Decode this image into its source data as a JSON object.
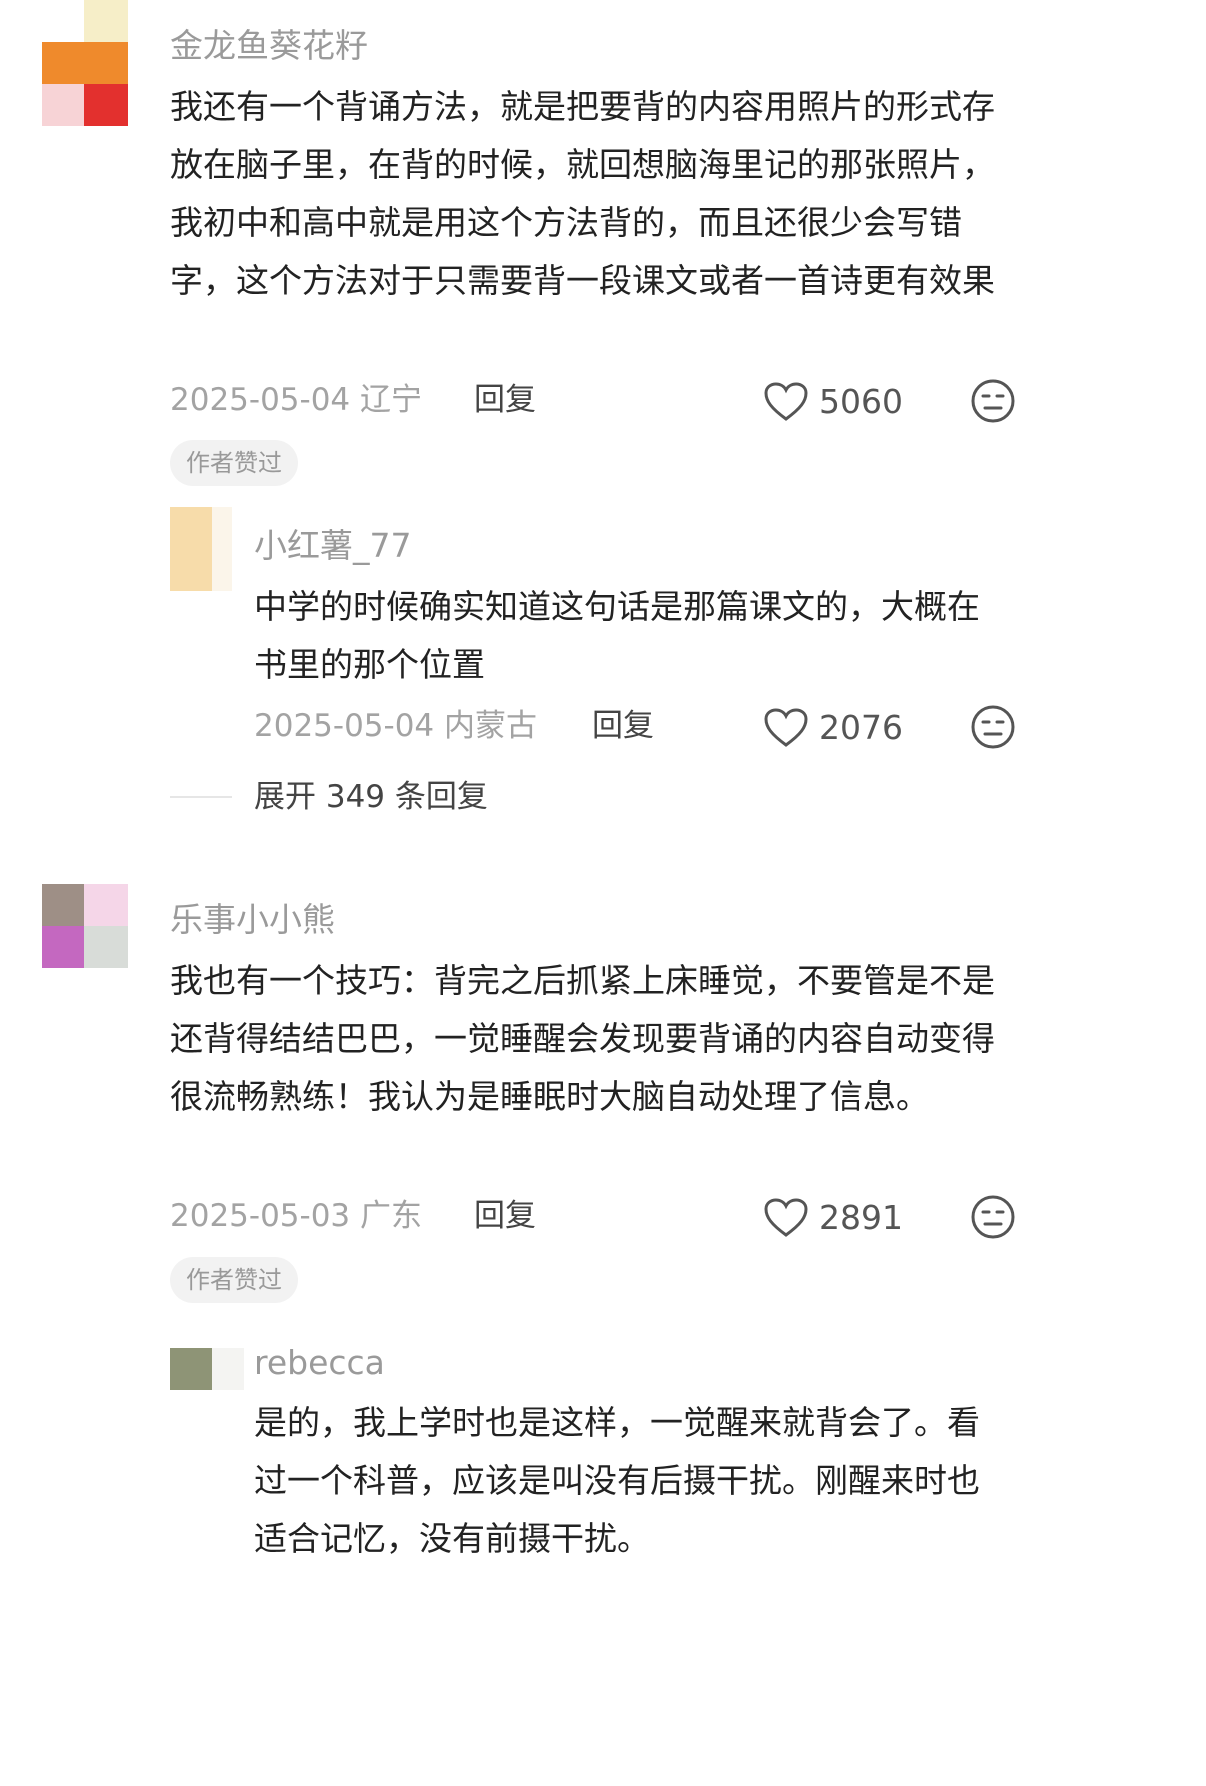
{
  "comments": [
    {
      "username": "金龙鱼葵花籽",
      "text": "我还有一个背诵方法，就是把要背的内容用照片的形式存放在脑子里，在背的时候，就回想脑海里记的那张照片，我初中和高中就是用这个方法背的，而且还很少会写错字，这个方法对于只需要背一段课文或者一首诗更有效果",
      "date": "2025-05-04",
      "location": "辽宁",
      "reply_label": "回复",
      "likes": "5060",
      "author_tag": "作者赞过",
      "replies": [
        {
          "username": "小红薯_77",
          "text": "中学的时候确实知道这句话是那篇课文的，大概在书里的那个位置",
          "date": "2025-05-04",
          "location": "内蒙古",
          "reply_label": "回复",
          "likes": "2076"
        }
      ],
      "expand_label": "展开 349 条回复"
    },
    {
      "username": "乐事小小熊",
      "text": "我也有一个技巧：背完之后抓紧上床睡觉，不要管是不是还背得结结巴巴，一觉睡醒会发现要背诵的内容自动变得很流畅熟练！我认为是睡眠时大脑自动处理了信息。",
      "date": "2025-05-03",
      "location": "广东",
      "reply_label": "回复",
      "likes": "2891",
      "author_tag": "作者赞过",
      "replies": [
        {
          "username": "rebecca",
          "text": "是的，我上学时也是这样，一觉醒来就背会了。看过一个科普，应该是叫没有后摄干扰。刚醒来时也适合记忆，没有前摄干扰。"
        }
      ]
    }
  ],
  "colors": {
    "background": "#ffffff",
    "text": "#222222",
    "meta": "#a3a3a3",
    "tag_bg": "#f2f2f2"
  },
  "icons": {
    "like": "heart-outline-icon",
    "dislike": "neutral-face-icon"
  }
}
